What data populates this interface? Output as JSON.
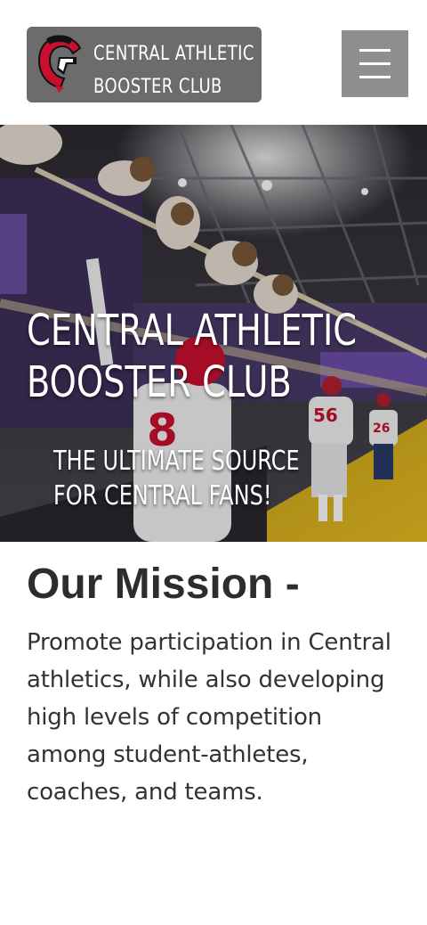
{
  "header": {
    "logo_line1": "CENTRAL ATHLETIC",
    "logo_line2": "BOOSTER CLUB",
    "logo_icon": "spartan-helmet-c-logo",
    "menu_icon": "hamburger-menu-icon"
  },
  "hero": {
    "title": "CENTRAL ATHLETIC\nBOOSTER CLUB",
    "subtitle": "THE ULTIMATE SOURCE\nFOR CENTRAL FANS!"
  },
  "mission": {
    "heading": "Our Mission -",
    "body": "Promote participation in Central athletics, while also developing high levels of competition among student-athletes, coaches, and teams."
  },
  "colors": {
    "logo_bg": "#6c6c6c",
    "menu_bg": "#8f8f8f",
    "brand_red": "#c8102e",
    "heading_text": "#2d2d2d"
  }
}
